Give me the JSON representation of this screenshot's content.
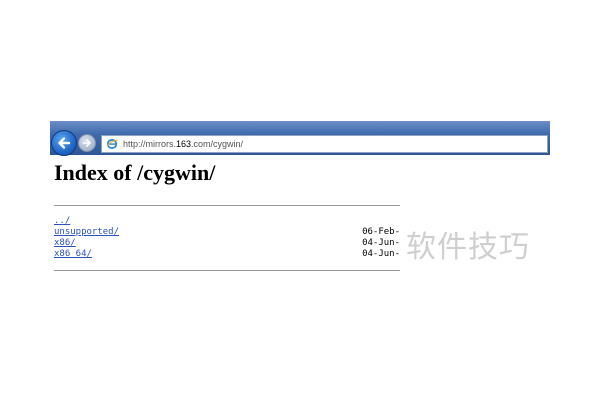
{
  "browser": {
    "address": {
      "prefix": "http://mirrors.",
      "host": "163",
      "suffix": ".com/cygwin/"
    },
    "toolbar_color": "#3f69ad"
  },
  "page": {
    "title": "Index of /cygwin/",
    "entries": [
      {
        "name": "../",
        "date": ""
      },
      {
        "name": "unsupported/",
        "date": "06-Feb-"
      },
      {
        "name": "x86/",
        "date": "04-Jun-"
      },
      {
        "name": "x86_64/",
        "date": "04-Jun-"
      }
    ],
    "link_color": "#2a52be"
  },
  "watermark": "软件技巧"
}
